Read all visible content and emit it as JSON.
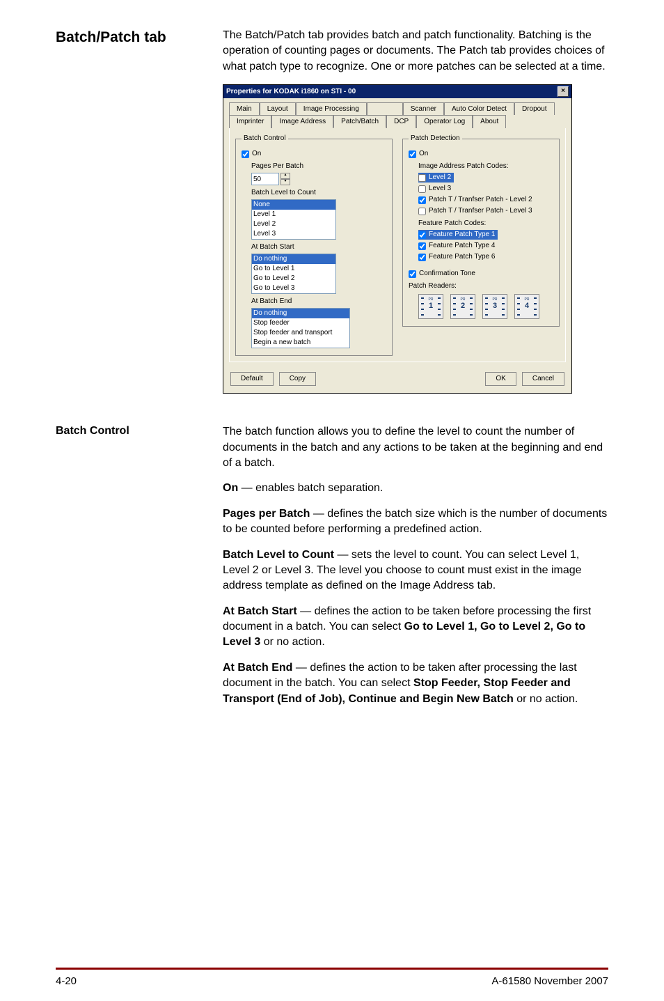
{
  "headings": {
    "main": "Batch/Patch tab",
    "sub1": "Batch Control"
  },
  "intro": "The Batch/Patch tab provides batch and patch functionality. Batching is the operation of counting pages or documents. The Patch tab provides choices of what patch type to recognize. One or more patches can be selected at a time.",
  "dialog": {
    "title": "Properties for KODAK i1860 on STI - 00",
    "tabs_row1": [
      "Main",
      "Layout",
      "Image Processing",
      "",
      "Scanner",
      "Auto Color Detect",
      "Dropout"
    ],
    "tabs_row2": [
      "Imprinter",
      "Image Address",
      "Patch/Batch",
      "DCP",
      "Operator Log",
      "About"
    ],
    "batch": {
      "legend": "Batch Control",
      "on": "On",
      "ppb": "Pages Per Batch",
      "ppb_val": "50",
      "blc": "Batch Level to Count",
      "blc_opts": [
        "None",
        "Level 1",
        "Level 2",
        "Level 3"
      ],
      "abs": "At Batch Start",
      "abs_opts": [
        "Do nothing",
        "Go to Level 1",
        "Go to Level 2",
        "Go to Level 3"
      ],
      "abe": "At Batch End",
      "abe_opts": [
        "Do nothing",
        "Stop feeder",
        "Stop feeder and transport",
        "Begin a new batch"
      ]
    },
    "patch": {
      "legend": "Patch Detection",
      "on": "On",
      "iapc": "Image Address Patch Codes:",
      "iapc_opts": [
        "Level 2",
        "Level 3",
        "Patch T / Tranfser Patch - Level 2",
        "Patch T / Tranfser Patch - Level 3"
      ],
      "fpc": "Feature Patch Codes:",
      "fpc_opts": [
        "Feature Patch Type 1",
        "Feature Patch Type 4",
        "Feature Patch Type 6"
      ],
      "confirm": "Confirmation Tone",
      "readers": "Patch Readers:",
      "reader_nums": [
        "1",
        "2",
        "3",
        "4"
      ]
    },
    "buttons": {
      "default": "Default",
      "copy": "Copy",
      "ok": "OK",
      "cancel": "Cancel"
    }
  },
  "body": {
    "p1": "The batch function allows you to define the level to count the number of documents in the batch and any actions to be taken at the beginning and end of a batch.",
    "on_l": "On",
    "on_t": " — enables batch separation.",
    "ppb_l": "Pages per Batch",
    "ppb_t": " — defines the batch size which is the number of documents to be counted before performing a predefined action.",
    "blc_l": "Batch Level to Count",
    "blc_t": " — sets the level to count. You can select Level 1, Level 2 or Level 3. The level you choose to count must exist in the image address template as defined on the Image Address tab.",
    "abs_l": "At Batch Start",
    "abs_t1": " — defines the action to be taken before processing the first document in a batch. You can select ",
    "abs_b": "Go to Level 1, Go to Level 2, Go to Level 3",
    "abs_t2": " or no action.",
    "abe_l": "At Batch End",
    "abe_t1": " — defines the action to be taken after processing the last document in the batch. You can select ",
    "abe_b": "Stop Feeder, Stop Feeder and Transport (End of Job), Continue and Begin New Batch",
    "abe_t2": " or no action."
  },
  "footer": {
    "left": "4-20",
    "right": "A-61580  November 2007"
  }
}
